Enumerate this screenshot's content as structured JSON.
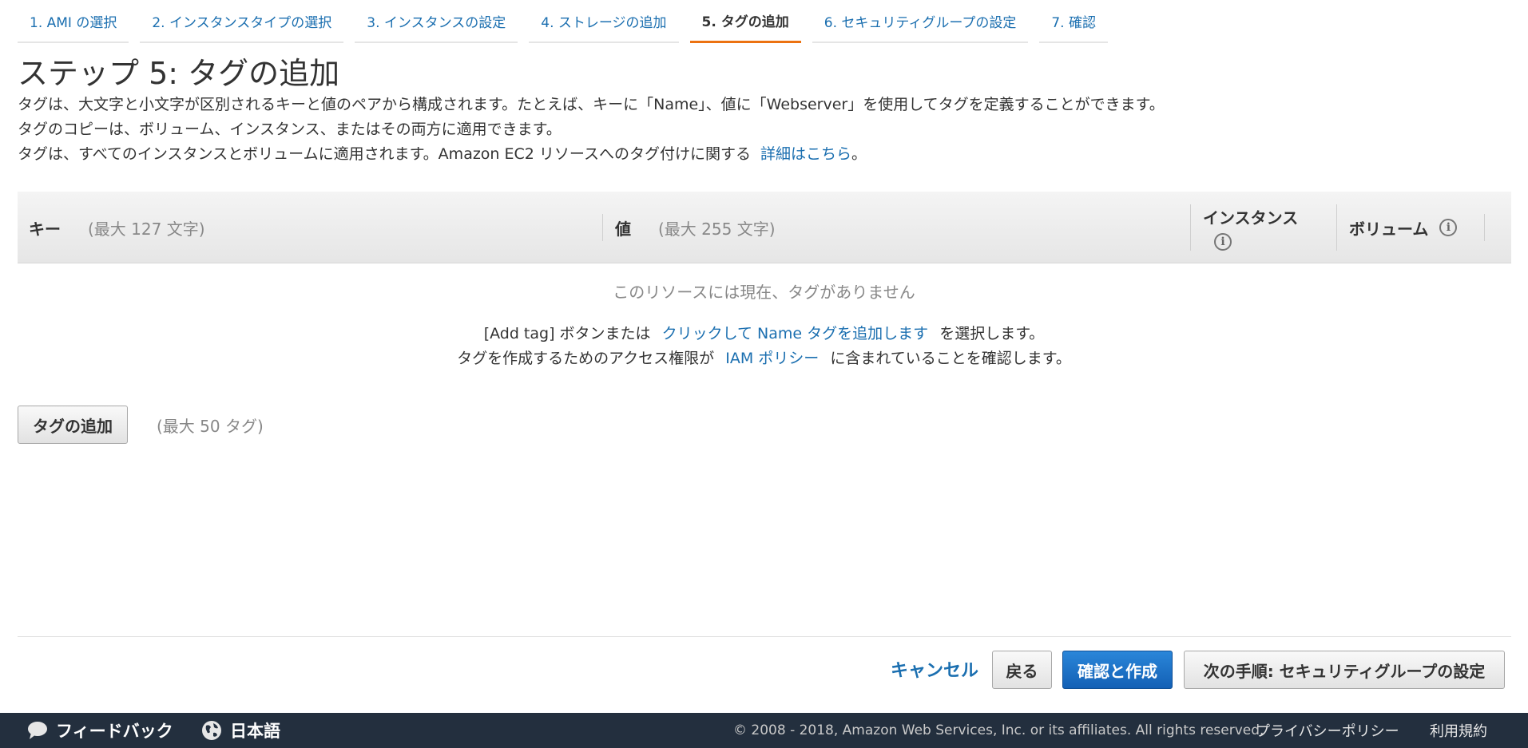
{
  "wizard": {
    "steps": [
      {
        "label": "1. AMI の選択"
      },
      {
        "label": "2. インスタンスタイプの選択"
      },
      {
        "label": "3. インスタンスの設定"
      },
      {
        "label": "4. ストレージの追加"
      },
      {
        "label": "5. タグの追加"
      },
      {
        "label": "6. セキュリティグループの設定"
      },
      {
        "label": "7. 確認"
      }
    ],
    "active_step": "5. タグの追加"
  },
  "page": {
    "title": "ステップ 5: タグの追加",
    "desc1": "タグは、大文字と小文字が区別されるキーと値のペアから構成されます。たとえば、キーに「Name」、値に「Webserver」を使用してタグを定義することができます。",
    "desc2": "タグのコピーは、ボリューム、インスタンス、またはその両方に適用できます。",
    "desc3_text": "タグは、すべてのインスタンスとボリュームに適用されます。Amazon EC2 リソースへのタグ付けに関する",
    "desc3_link": "詳細はこちら",
    "desc3_end": "。"
  },
  "table": {
    "key_header": "キー",
    "key_hint": "(最大 127 文字)",
    "value_header": "値",
    "value_hint": "(最大 255 文字)",
    "instance_header": "インスタンス",
    "volume_header": "ボリューム",
    "info_glyph": "i"
  },
  "empty": {
    "title": "このリソースには現在、タグがありません",
    "line1_pre": "[Add tag] ボタンまたは",
    "line1_link": "クリックして Name タグを追加します",
    "line1_post": "を選択します。",
    "line2_pre": "タグを作成するためのアクセス権限が",
    "line2_link": "IAM ポリシー",
    "line2_post": "に含まれていることを確認します。"
  },
  "actions": {
    "add_tag": "タグの追加",
    "add_tag_limit": "(最大 50 タグ)",
    "cancel": "キャンセル",
    "back": "戻る",
    "review_launch": "確認と作成",
    "next": "次の手順: セキュリティグループの設定"
  },
  "footer": {
    "feedback": "フィードバック",
    "language": "日本語",
    "copyright": "© 2008 - 2018, Amazon Web Services, Inc. or its affiliates. All rights reserved.",
    "privacy": "プライバシーポリシー",
    "terms": "利用規約"
  },
  "colors": {
    "accent": "#ec7211",
    "link": "#1b6fb0",
    "primary_button": "#1a6fc4",
    "footer_bg": "#232f3e"
  },
  "icons": {
    "info": "info-icon",
    "feedback": "speech-bubble-icon",
    "language": "globe-icon"
  }
}
